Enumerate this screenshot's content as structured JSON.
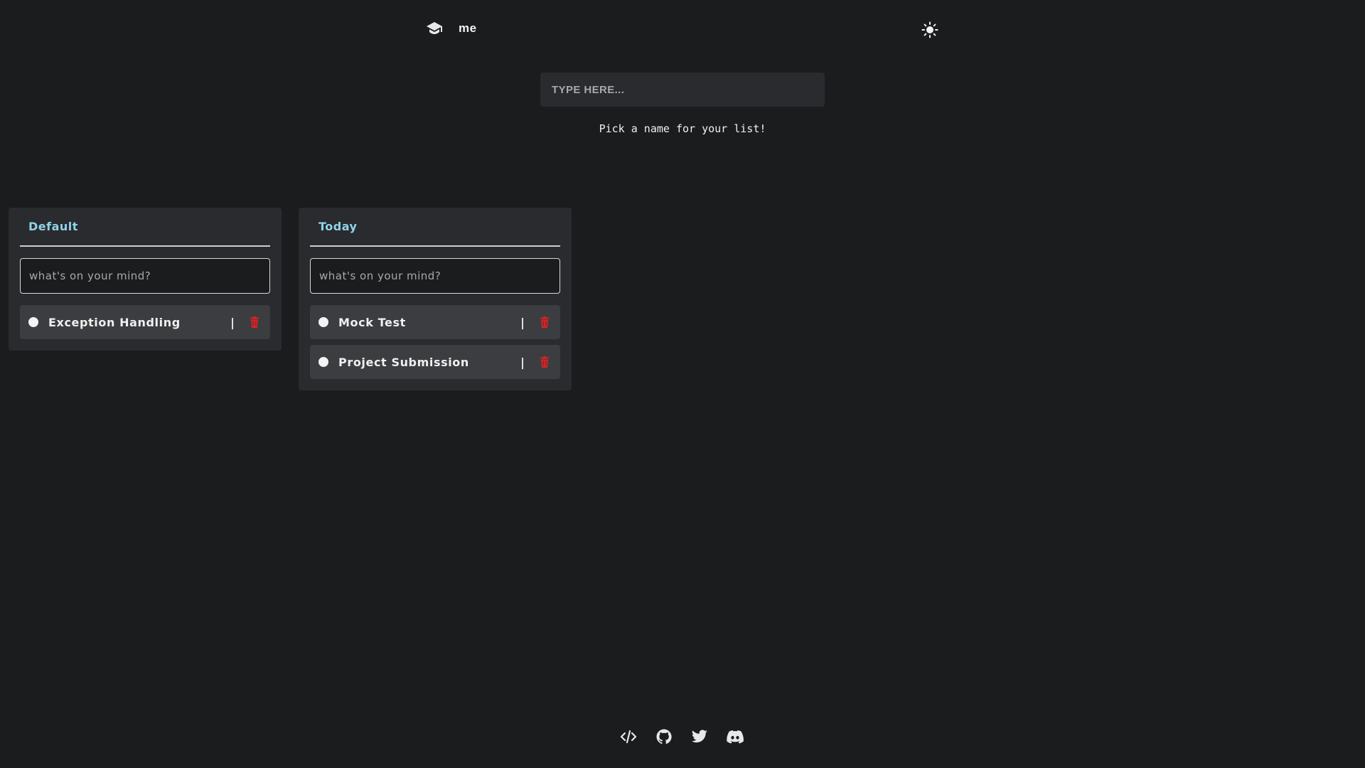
{
  "header": {
    "username": "me",
    "logo_icon": "graduation-cap-icon",
    "theme_icon": "sun-icon"
  },
  "new_list": {
    "placeholder": "TYPE HERE...",
    "hint": "Pick a name for your list!"
  },
  "lists": [
    {
      "title": "Default",
      "input_placeholder": "what's on your mind?",
      "tasks": [
        {
          "text": "Exception Handling",
          "separator": "|",
          "delete_icon": "trash-icon"
        }
      ]
    },
    {
      "title": "Today",
      "input_placeholder": "what's on your mind?",
      "tasks": [
        {
          "text": "Mock Test",
          "separator": "|",
          "delete_icon": "trash-icon"
        },
        {
          "text": "Project Submission",
          "separator": "|",
          "delete_icon": "trash-icon"
        }
      ]
    }
  ],
  "footer": {
    "icons": [
      "code-icon",
      "github-icon",
      "twitter-icon",
      "discord-icon"
    ]
  },
  "colors": {
    "background": "#1b1c1e",
    "card": "#2a2b2e",
    "task": "#3c3d40",
    "list_title": "#8fd3ea",
    "delete": "#e02020"
  }
}
